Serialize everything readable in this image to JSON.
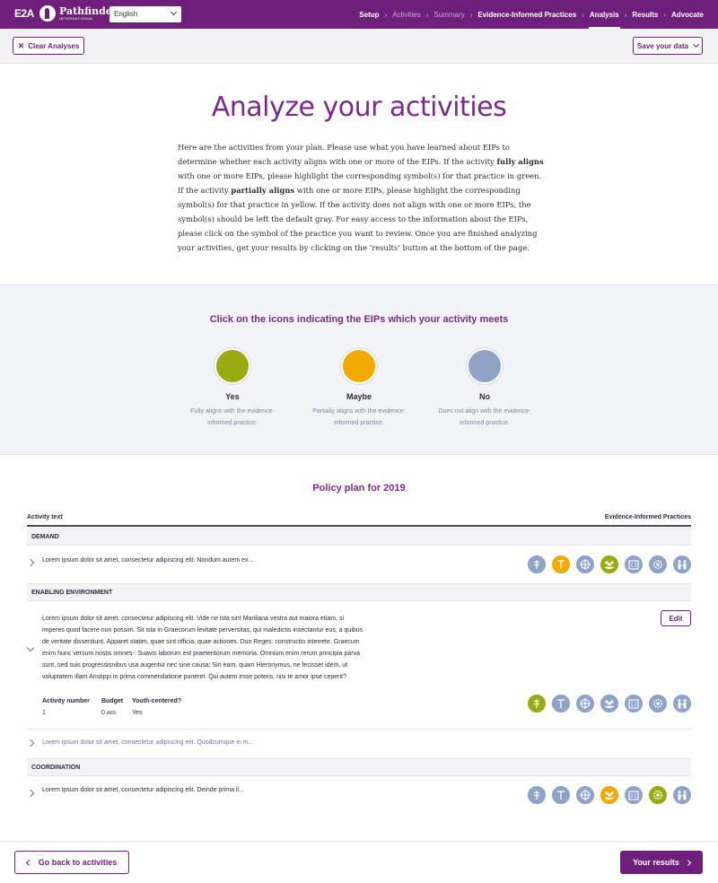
{
  "nav": {
    "logo_e2a": "E2A",
    "logo_pathfinder": "Pathfinder",
    "logo_pathfinder_sub": "INTERNATIONAL",
    "language": "English",
    "steps": [
      {
        "label": "Setup",
        "state": "done"
      },
      {
        "label": "Activities",
        "state": "dim"
      },
      {
        "label": "Summary",
        "state": "dim"
      },
      {
        "label": "Evidence-Informed Practices",
        "state": "done"
      },
      {
        "label": "Analysis",
        "state": "active"
      },
      {
        "label": "Results",
        "state": "done"
      },
      {
        "label": "Advocate",
        "state": "done"
      }
    ]
  },
  "toolbar": {
    "clear_label": "Clear Analyses",
    "save_label": "Save your data"
  },
  "page": {
    "title": "Analyze your activities",
    "intro_parts": [
      {
        "t": "Here are the activities from your plan. Please use what you have learned about EIPs to determine whether each activity aligns with one or more of the EIPs. If the activity ",
        "b": false
      },
      {
        "t": "fully aligns",
        "b": true
      },
      {
        "t": " with one or more EIPs, please highlight the corresponding symbol(s) for that practice in green. If the activity ",
        "b": false
      },
      {
        "t": "partially aligns",
        "b": true
      },
      {
        "t": " with one or more EIPs, please highlight the corresponding symbol(s) for that practice in yellow. If the activity does not align with one or more EIPs, the symbol(s) should be left the default gray. For easy access to the information about the EIPs, please click on the symbol of the practice you want to review. Once you are finished analyzing your activities, get your results by clicking on the ‘results’ button at the bottom of the page.",
        "b": false
      }
    ]
  },
  "legend": {
    "title": "Click on the icons indicating the EIPs which your activity meets",
    "items": [
      {
        "label": "Yes",
        "desc1": "Fully aligns with the evidence-",
        "desc2": "informed practice.",
        "color": "#9aab12"
      },
      {
        "label": "Maybe",
        "desc1": "Partially aligns with the evidence-",
        "desc2": "informed practice.",
        "color": "#f2a900"
      },
      {
        "label": "No",
        "desc1": "Does not align with the evidence-",
        "desc2": "informed practice.",
        "color": "#8fa3c6"
      }
    ]
  },
  "plan": {
    "title": "Policy plan for 2019",
    "col_activity": "Activity text",
    "col_eip": "Evidence-Informed Practices",
    "sections": {
      "demand": "DEMAND",
      "enabling": "ENABLING ENVIRONMENT",
      "coordination": "COORDINATION"
    },
    "rows": {
      "demand_1": "Lorem ipsum dolor sit amet, consectetur adipiscing elit. Nondum autem ex...",
      "enabling_expanded": "Lorem ipsum dolor sit amet, consectetur adipiscing elit. Vide ne ista sint Manliana vestra aut maiora etiam, si imperes quod facere non possim. Sit ista in Graecorum levitate perversitas, qui maledictis insectantur eos, a quibus de veritate dissentiunt. Apparet statim, quae sint officia, quae actiones. Duo Reges: constructio interrete. Graecum enim hunc versum nostis omnes-: Suavis laborum est praeteritorum memoria. Omnium enim rerum principia parva sunt, sed suis progressionibus usa augentur nec sine causa; Sin eam, quam Hieronymus, ne fecisset idem, ut voluptatem illam Aristippi in prima commendatione poneret. Qui autem esse poteris, nisi te amor ipse ceperit?",
      "enabling_2": "Lorem ipsum dolor sit amet, consectetur adipiscing elit. Quodcumque in m...",
      "coordination_1": "Lorem ipsum dolor sit amet, consectetur adipiscing elit. Deinde prima il..."
    },
    "meta": {
      "activity_number_label": "Activity number",
      "activity_number": "1",
      "budget_label": "Budget",
      "budget": "0",
      "budget_currency": "ARS",
      "youth_label": "Youth-centered?",
      "youth": "Yes"
    },
    "edit_label": "Edit",
    "eip_icons": [
      "medical-icon",
      "iud-icon",
      "crosshair-icon",
      "group-icon",
      "facility-icon",
      "gear-people-icon",
      "couple-icon"
    ],
    "eip_states": {
      "demand_1": [
        "no",
        "maybe",
        "no",
        "yes",
        "no",
        "no",
        "no"
      ],
      "enabling_expanded": [
        "yes",
        "no",
        "no",
        "no",
        "no",
        "no",
        "no"
      ],
      "coordination_1": [
        "no",
        "no",
        "no",
        "maybe",
        "no",
        "yes",
        "no"
      ]
    },
    "state_colors": {
      "yes": "#9aab12",
      "maybe": "#f2a900",
      "no": "#8fa3c6"
    }
  },
  "footer": {
    "back_label": "Go back to activities",
    "results_label": "Your results"
  }
}
